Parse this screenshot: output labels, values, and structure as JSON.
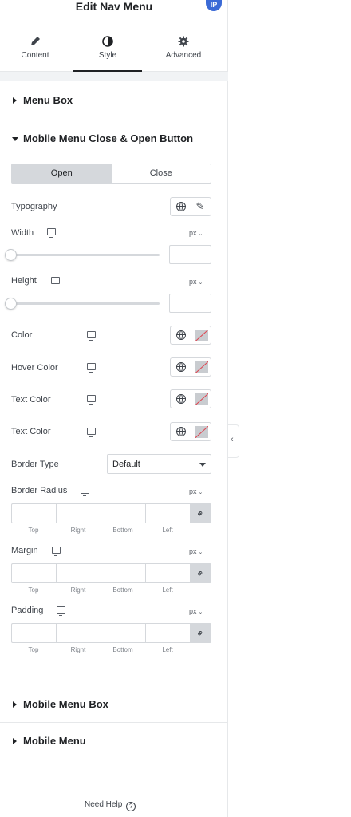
{
  "header": {
    "title": "Edit Nav Menu",
    "badge": "IP"
  },
  "tabs": [
    {
      "label": "Content",
      "icon": "pencil-icon"
    },
    {
      "label": "Style",
      "icon": "contrast-icon",
      "active": true
    },
    {
      "label": "Advanced",
      "icon": "gear-icon"
    }
  ],
  "sections": {
    "menu_box": "Menu Box",
    "mobile_button": "Mobile Menu Close & Open Button",
    "mobile_menu_box": "Mobile Menu Box",
    "mobile_menu": "Mobile Menu"
  },
  "state_toggle": {
    "open": "Open",
    "close": "Close",
    "selected": "Open"
  },
  "controls": {
    "typography": "Typography",
    "width": {
      "label": "Width",
      "unit": "px",
      "value": ""
    },
    "height": {
      "label": "Height",
      "unit": "px",
      "value": ""
    },
    "color": "Color",
    "hover_color": "Hover Color",
    "text_color_1": "Text Color",
    "text_color_2": "Text Color",
    "border_type": {
      "label": "Border Type",
      "value": "Default"
    },
    "border_radius": {
      "label": "Border Radius",
      "unit": "px"
    },
    "margin": {
      "label": "Margin",
      "unit": "px"
    },
    "padding": {
      "label": "Padding",
      "unit": "px"
    }
  },
  "dimension_labels": {
    "top": "Top",
    "right": "Right",
    "bottom": "Bottom",
    "left": "Left"
  },
  "footer": {
    "need_help": "Need Help",
    "help_glyph": "?"
  },
  "colors": {
    "accent": "#3b6ad6",
    "active_segment": "#d5d8dc",
    "unset_swatch_line": "#e0424e"
  }
}
